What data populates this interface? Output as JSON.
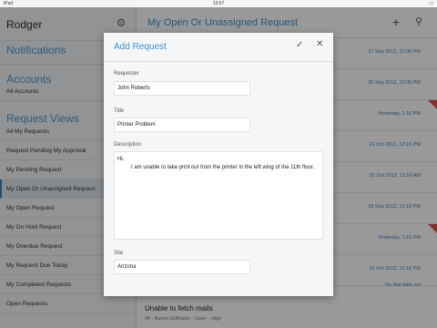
{
  "status_bar": {
    "carrier": "iPad",
    "time": "13:57",
    "battery": "▭"
  },
  "sidebar": {
    "username": "Rodger",
    "gear_icon": "gear-icon",
    "notifications": "Notifications",
    "accounts_heading": "Accounts",
    "all_accounts": "All Accounts",
    "request_views_heading": "Request Views",
    "items": [
      "All My Requests",
      "Request Pending My Approval",
      "My Pending Request",
      "My Open Or Unassigned Request",
      "My Open Request",
      "My On Hold Request",
      "My Overdue Request",
      "My Request Due Today",
      "My Completed Requests",
      "Open Requests"
    ],
    "active_index": 3
  },
  "main": {
    "title": "My Open Or Unassigned Request",
    "rows": [
      {
        "date": "27 Sep 2012, 12:00 PM",
        "flag": false
      },
      {
        "date": "30 Sep 2012, 12:00 PM",
        "flag": false
      },
      {
        "date": "Yesterday, 1:16 PM",
        "flag": true
      },
      {
        "date": "21 Oct 2012, 12:16 PM",
        "flag": false
      },
      {
        "date": "01 Oct 2012, 11:16 AM",
        "flag": false
      },
      {
        "date": "28 Sep 2012, 12:16 PM",
        "flag": false
      },
      {
        "date": "Yesterday, 1:15 PM",
        "flag": true
      },
      {
        "date": "16 Oct 2012, 12:16 PM",
        "flag": false
      },
      {
        "date": "No due date set",
        "flag": false
      }
    ],
    "last_row": {
      "title": "Unable to fetch mails",
      "meta": "#8  -  Baron Griffindor  -  Open  -  High"
    },
    "accent_color": "#3c8fcc",
    "flag_color": "#d9534f"
  },
  "modal": {
    "title": "Add Request",
    "requester_label": "Requester",
    "requester_value": "John Roberts",
    "title_label": "Title",
    "title_value": "Printer Problem",
    "description_label": "Description",
    "description_value": "Hi,\n         I am unable to take print out from the printer in the left wing of the 11th floor.",
    "site_label": "Site",
    "site_value": "Arizona"
  }
}
